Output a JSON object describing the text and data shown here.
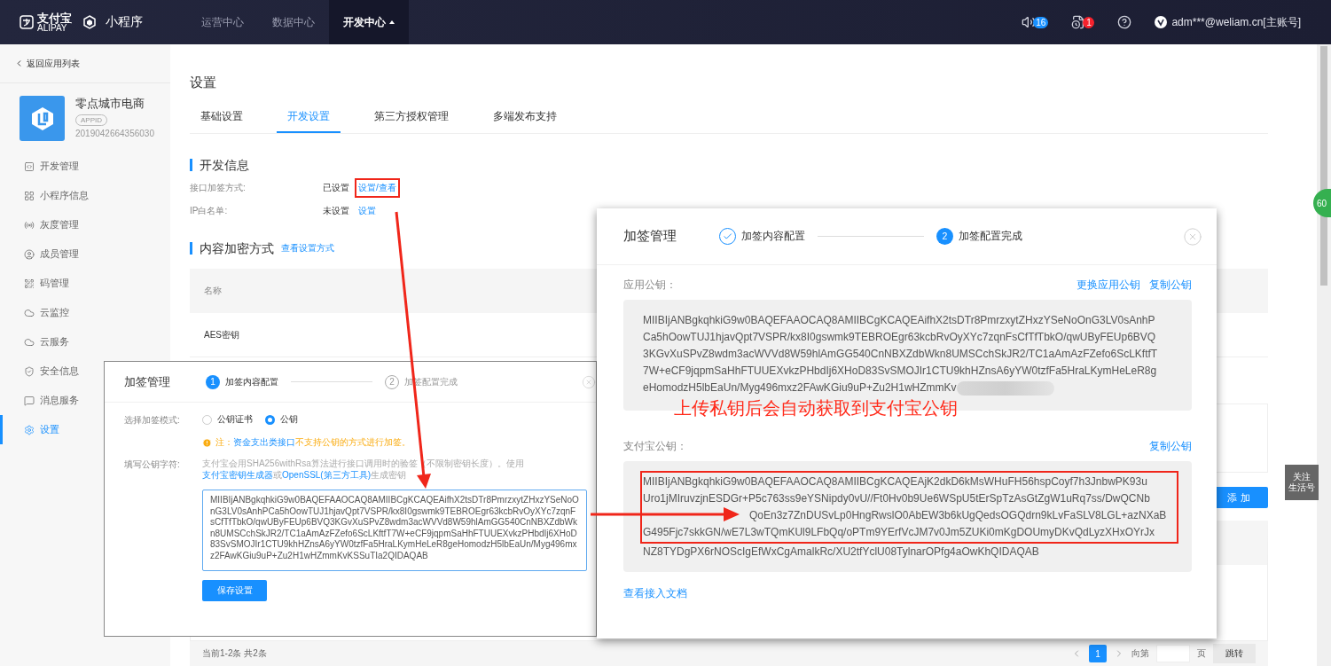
{
  "topbar": {
    "logo": "支付宝",
    "logo_sub": "ALIPAY",
    "product": "小程序",
    "nav": [
      {
        "label": "运营中心",
        "selected": false
      },
      {
        "label": "数据中心",
        "selected": false
      },
      {
        "label": "开发中心",
        "selected": true
      }
    ],
    "notices": [
      {
        "kind": "sound",
        "count": "16"
      },
      {
        "kind": "file",
        "count": "1"
      }
    ],
    "account": "adm***@weliam.cn[主账号]"
  },
  "sidebar": {
    "back": "返回应用列表",
    "app_name": "零点城市电商",
    "app_badge": "APPID",
    "app_id": "2019042664356030",
    "items": [
      {
        "kind": "code",
        "label": "开发管理",
        "selected": false
      },
      {
        "kind": "grid",
        "label": "小程序信息",
        "selected": false
      },
      {
        "kind": "broadcast",
        "label": "灰度管理",
        "selected": false
      },
      {
        "kind": "user",
        "label": "成员管理",
        "selected": false
      },
      {
        "kind": "qr",
        "label": "码管理",
        "selected": false
      },
      {
        "kind": "cloud",
        "label": "云监控",
        "selected": false
      },
      {
        "kind": "cloud",
        "label": "云服务",
        "selected": false
      },
      {
        "kind": "shield",
        "label": "安全信息",
        "selected": false
      },
      {
        "kind": "message",
        "label": "消息服务",
        "selected": false
      },
      {
        "kind": "settings",
        "label": "设置",
        "selected": true
      }
    ]
  },
  "main": {
    "title": "设置",
    "tabs": [
      {
        "label": "基础设置",
        "selected": false
      },
      {
        "label": "开发设置",
        "selected": true
      },
      {
        "label": "第三方授权管理",
        "selected": false
      },
      {
        "label": "多端发布支持",
        "selected": false
      }
    ],
    "dev_info": {
      "heading": "开发信息",
      "rows": [
        {
          "label": "接口加签方式:",
          "status": "已设置",
          "link": "设置/查看",
          "highlighted": true
        },
        {
          "label": "IP白名单:",
          "status": "未设置",
          "link": "设置"
        }
      ]
    },
    "content_encryption": {
      "heading": "内容加密方式",
      "link": "查看设置方式",
      "table": {
        "columns": [
          "名称"
        ],
        "rows": [
          [
            "AES密钥"
          ]
        ]
      }
    },
    "add_button": "添 加",
    "footer": {
      "summary": "当前1-2条 共2条",
      "page": "1",
      "goto_prefix": "向第",
      "goto_suffix": "页",
      "goto_button": "跳转"
    }
  },
  "dialog_small": {
    "title": "加签管理",
    "steps": [
      {
        "number": "1",
        "label": "加签内容配置",
        "active": true,
        "done": false
      },
      {
        "number": "2",
        "label": "加签配置完成",
        "active": false,
        "done": false
      }
    ],
    "mode_label": "选择加签模式:",
    "modes": [
      {
        "label": "公钥证书",
        "selected": false
      },
      {
        "label": "公钥",
        "selected": true
      }
    ],
    "note": [
      {
        "kind": "warn",
        "text": "注："
      },
      {
        "kind": "link",
        "text": "资金支出类接口"
      },
      {
        "kind": "warn",
        "text": "不支持公钥的方式进行加签。"
      }
    ],
    "key_label": "填写公钥字符:",
    "hint": [
      {
        "kind": "text",
        "text": "支付宝会用SHA256withRsa算法进行接口调用时的验签（不限制密钥长度）。使用"
      },
      {
        "kind": "link",
        "text": "支付宝密钥生成器"
      },
      {
        "kind": "text",
        "text": "或"
      },
      {
        "kind": "link",
        "text": "OpenSSL(第三方工具)"
      },
      {
        "kind": "text",
        "text": "生成密钥"
      }
    ],
    "key_value": "MIIBIjANBgkqhkiG9w0BAQEFAAOCAQ8AMIIBCgKCAQEAifhX2tsDTr8PmrzxytZHxzYSeNoOnG3LV0sAnhPCa5hOowTUJ1hjavQpt7VSPR/kx8I0gswmk9TEBROEgr63kcbRvOyXYc7zqnFsCfTfTbkO/qwUByFEUp6BVQ3KGvXuSPvZ8wdm3acWVVd8W59hlAmGG540CnNBXZdbWkn8UMSCchSkJR2/TC1aAmAzFZefo6ScLKftfT7W+eCF9jqpmSaHhFTUUEXvkzPHbdIj6XHoD83SvSMOJIr1CTU9khHZnsA6yYW0tzfFa5HraLKymHeLeR8geHomodzH5lbEaUn/Myg496mxz2FAwKGiu9uP+Zu2H1wHZmmKvKSSuTIa2QIDAQAB",
    "save": "保存设置"
  },
  "dialog_large": {
    "title": "加签管理",
    "steps": [
      {
        "label": "加签内容配置",
        "done": true
      },
      {
        "number": "2",
        "label": "加签配置完成",
        "active": true,
        "done": false
      }
    ],
    "app_key": {
      "label": "应用公钥：",
      "actions": [
        "更换应用公钥",
        "复制公钥"
      ],
      "lines": [
        {
          "text": "MIIBIjANBgkqhkiG9w0BAQEFAAOCAQ8AMIIBCgKCAQEAifhX2tsDTr8PmrzxytZHxzYSeNoOnG3LV0sAnhP",
          "hidden_start": false,
          "highlighted": false
        },
        {
          "text": "Ca5hOowTUJ1hjavQpt7VSPR/kx8I0gswmk9TEBROEgr63kcbRvOyXYc7zqnFsCfTfTbkO/qwUByFEUp6BVQ",
          "hidden_start": false,
          "highlighted": false
        },
        {
          "text": "3KGvXuSPvZ8wdm3acWVVd8W59hlAmGG540CnNBXZdbWkn8UMSCchSkJR2/TC1aAmAzFZefo6ScLKftfT",
          "hidden_start": false,
          "highlighted": false
        },
        {
          "text": "7W+eCF9jqpmSaHhFTUUEXvkzPHbdIj6XHoD83SvSMOJIr1CTU9khHZnsA6yYW0tzfFa5HraLKymHeLeR8g",
          "hidden_start": false,
          "highlighted": false
        },
        {
          "text": "eHomodzH5lbEaUn/Myg496mxz2FAwKGiu9uP+Zu2H1wHZmmKv",
          "hidden_start": false,
          "highlighted": false
        }
      ],
      "redacted": true
    },
    "alipay_key": {
      "label": "支付宝公钥：",
      "actions": [
        "复制公钥"
      ],
      "lines": [
        {
          "text": "MIIBIjANBgkqhkiG9w0BAQEFAAOCAQ8AMIIBCgKCAQEAjK2dkD6kMsWHuFH56hspCoyf7h3JnbwPK93u",
          "hidden_start": false,
          "highlighted": true
        },
        {
          "text": "Uro1jMIruvzjnESDGr+P5c763ss9eYSNipdy0vU//Ft0Hv0b9Ue6WSpU5tErSpTzAsGtZgW1uRq7ss/DwQCNb",
          "hidden_start": false,
          "highlighted": true
        },
        {
          "text": "QoEn3z7ZnDUSvLp0HngRwslO0AbEW3b6kUgQedsOGQdrn9kLvFaSLV8LGL+azNXaB",
          "hidden_start": true,
          "highlighted": true
        },
        {
          "text": "G495Fjc7skkGN/wE7L3wTQmKUl9LFbQq/oPTm9YErfVcJM7v0Jm5ZUKi0mKgDOUmyDKvQdLyzXHxOYrJx",
          "hidden_start": false,
          "highlighted": true
        },
        {
          "text": "NZ8TYDgPX6rNOScIgEfWxCgAmalkRc/XU2tfYclU08TylnarOPfg4aOwKhQIDAQAB",
          "hidden_start": false,
          "highlighted": false
        }
      ]
    },
    "docs_link": "查看接入文档"
  },
  "annotation": "上传私钥后会自动获取到支付宝公钥",
  "follow_button": [
    "关注",
    "生活号"
  ],
  "edge_badge": "60"
}
